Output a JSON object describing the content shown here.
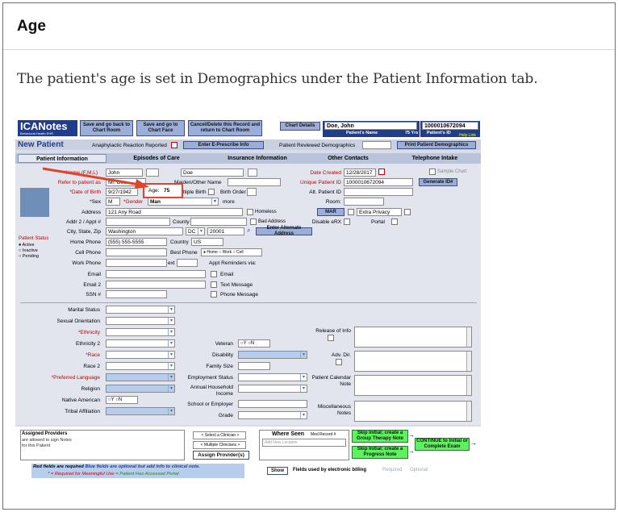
{
  "page": {
    "title": "Age",
    "description": "The patient's age is set in Demographics under the Patient Information tab."
  },
  "app": {
    "logo": "ICANotes",
    "logo_sub": "Behavioral Health EHR",
    "top_buttons": [
      "Save and go back to Chart Room",
      "Save and go to Chart Face",
      "Cancel/Delete this Record and return to Chart Room",
      "Chart Details"
    ],
    "patient_name": "Doe, John",
    "patient_name_label": "Patient's Name",
    "patient_id": "1000010672094",
    "age_short": "75 Yrs",
    "patient_id_label": "Patient's ID",
    "help": "Help Link",
    "title": "New Patient",
    "anaphylactic": "Anaphylactic Reaction Reported",
    "eprescribe": "Enter E-Prescribe Info",
    "reviewed": "Patient Reviewed Demographics",
    "print": "Print Patient Demographics",
    "tabs": [
      "Patient Information",
      "Episodes of Care",
      "Insurance Information",
      "Other Contacts",
      "Telephone Intake"
    ],
    "sample_chart": "Sample Chart"
  },
  "form": {
    "name_label": "*Name (F,M,L)",
    "first": "John",
    "last": "Doe",
    "refer_label": "Refer to patient as",
    "refer": "Mr. Doe",
    "maiden_label": "Maiden/Other Name",
    "dob_label": "*Date of Birth",
    "dob": "9/27/1942",
    "age_label": "Age:",
    "age": "75",
    "multiple_birth": "Multiple Birth",
    "birth_order": "Birth Order",
    "sex_label": "*Sex",
    "sex": "M",
    "gender_label": "*Gender",
    "gender": "Man",
    "more": "more",
    "address_label": "Address",
    "address": "121 Any Road",
    "homeless": "Homeless",
    "addr2_label": "Addr 2 / Appt #",
    "county": "County",
    "bad_address": "Bad Address",
    "city_label": "City, State, Zip",
    "city": "Washington",
    "state": "DC",
    "zip": "20001",
    "alt_address": "Enter Alternate Address",
    "status_label": "Patient Status",
    "status_options": [
      "Active",
      "Inactive",
      "Pending"
    ],
    "home_phone_label": "Home Phone",
    "home_phone": "(555) 555-5555",
    "country_label": "Country",
    "country": "US",
    "cell_label": "Cell Phone",
    "best_phone": "Best Phone",
    "best_options": [
      "Home",
      "Work",
      "Cell"
    ],
    "work_label": "Work Phone",
    "ext": "ext",
    "appt_reminders": "Appt Reminders via:",
    "email_label": "Email",
    "email2_label": "Email 2",
    "ssn_label": "SSN #",
    "r_email": "Email",
    "r_text": "Text Message",
    "r_phone": "Phone Message",
    "date_created_label": "Date Created",
    "date_created": "12/28/2017",
    "unique_id_label": "Unique Patient ID",
    "unique_id": "1000010672094",
    "generate_id": "Generate ID#",
    "alt_id_label": "Alt. Patient ID",
    "room_label": "Room:",
    "mar": "MAR",
    "extra_privacy": "Extra Privacy",
    "disable_erx": "Disable eRX",
    "portal": "Portal"
  },
  "demo": {
    "left_labels": [
      "Marital Status",
      "Sexual Orientation",
      "*Ethnicity",
      "Ethnicity 2",
      "*Race",
      "Race 2",
      "*Preferred Language",
      "Religion",
      "Native American",
      "Tribal Affiliation"
    ],
    "native_options": [
      "Y",
      "N"
    ],
    "mid_labels": [
      "Veteran",
      "Disability",
      "Family Size",
      "Employment Status",
      "Annual Household Income",
      "School or Employer",
      "Grade"
    ],
    "veteran_options": [
      "Y",
      "N"
    ],
    "right_labels": [
      "Release of Info",
      "Adv. Dir.",
      "Patient Calendar Note",
      "Miscellaneous Notes"
    ]
  },
  "bottom": {
    "assigned": "Assigned Providers",
    "assigned_sub": "are allowed to sign Notes for this Patient",
    "select_clinician": "< Select a Clinician >",
    "multiple_clinicians": "< Multiple Clinicians >",
    "assign_btn": "Assign Provider(s)",
    "where_seen": "Where Seen",
    "med_record": "Med Record #",
    "add_location": "Add New Location",
    "skip1": "Skip Initial; create a Group Therapy Note",
    "skip2": "Skip Initial; create a Progress Note",
    "continue": "CONTINUE to Initial or Complete Exam",
    "legend1": "Red fields are required",
    "legend2": "Blue fields are optional but add info to clinical note.",
    "legend3": "* = Required for Meaningful Use",
    "legend4": "= Patient Has Accessed Portal",
    "show": "Show",
    "billing": "Fields used by electronic billing",
    "required": "Required",
    "optional": "Optional"
  },
  "colors": {
    "highlight": "#e0452b",
    "header_blue": "#1f3d8c",
    "field_blue": "#b7cdee",
    "continue_green": "#5ef25e"
  }
}
